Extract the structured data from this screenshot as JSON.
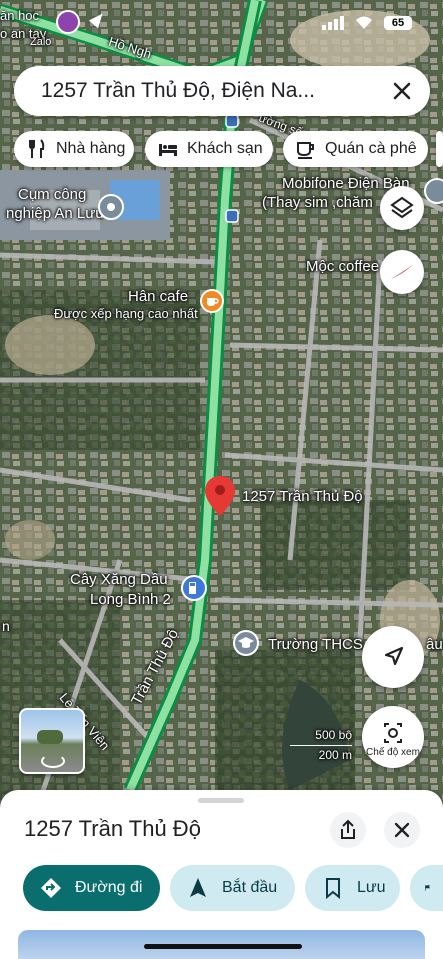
{
  "status_bar": {
    "left_text_1": "ăn hoc",
    "left_text_2": "o an tay",
    "zalo": "Zalo",
    "battery": "65"
  },
  "search": {
    "query": "1257 Trần Thủ Độ, Điện Na..."
  },
  "filter_chips": [
    {
      "label": "Nhà hàng",
      "icon": "fork-knife-icon"
    },
    {
      "label": "Khách sạn",
      "icon": "bed-icon"
    },
    {
      "label": "Quán cà phê",
      "icon": "coffee-cup-icon"
    }
  ],
  "map": {
    "pois": {
      "industrial": {
        "line1": "Cụm công",
        "line2": "nghiệp An Lưu"
      },
      "mobifone": {
        "line1": "Mobifone Điện Bàn",
        "line2": "(Thay sim ,chăm"
      },
      "moc_coffee": "Mộc coffee",
      "han_cafe": {
        "name": "Hân cafe",
        "sub": "Được xếp hạng cao nhất"
      },
      "pin": "1257 Trần Thủ Độ",
      "gas_station": {
        "line1": "Cây Xăng Dầu",
        "line2": "Long Bình 2"
      },
      "school": "Trường THCS",
      "school_suffix": "âu"
    },
    "roads": {
      "tran_thu_do": "Trần Thủ Độ",
      "le_tan_vien": "Lê Tấn Viên",
      "ho_nghinh": "Hồ Ngh",
      "top_right": "ường số",
      "left_edge": "n"
    },
    "scale": {
      "feet": "500 bộ",
      "meters": "200 m"
    },
    "colors": {
      "road": "#8ee0a3",
      "road_edge": "#0a8f42",
      "pin": "#e53935"
    }
  },
  "controls": {
    "layers": "layers-icon",
    "compass": "compass-icon",
    "location": "navigation-arrow-icon",
    "view_mode": "Chế độ xem"
  },
  "place_sheet": {
    "title": "1257 Trần Thủ Độ",
    "actions": {
      "directions": "Đường đi",
      "start": "Bắt đầu",
      "save": "Lưu"
    }
  }
}
